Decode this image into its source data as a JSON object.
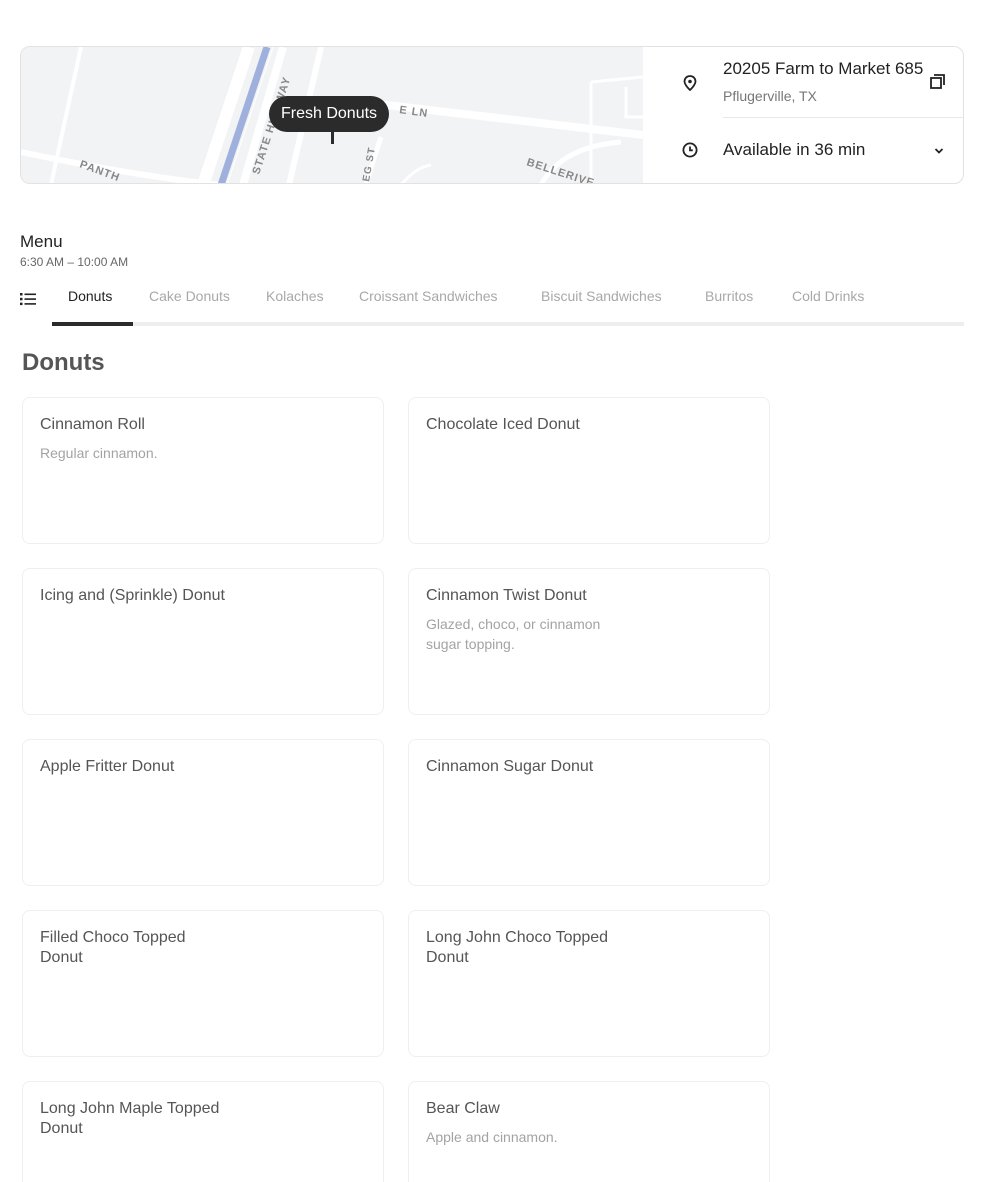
{
  "store": {
    "map_label": "Fresh Donuts",
    "map_street_labels": [
      "STATE HIGHWAY",
      "E LN",
      "PANTH",
      "EG ST",
      "BELLERIVE"
    ],
    "address_line1": "20205 Farm to Market 685",
    "address_line2": "Pflugerville, TX",
    "availability": "Available in 36 min"
  },
  "menu": {
    "title": "Menu",
    "hours": "6:30 AM – 10:00 AM"
  },
  "tabs": [
    {
      "label": "Donuts",
      "active": true
    },
    {
      "label": "Cake Donuts"
    },
    {
      "label": "Kolaches"
    },
    {
      "label": "Croissant Sandwiches"
    },
    {
      "label": "Biscuit Sandwiches"
    },
    {
      "label": "Burritos"
    },
    {
      "label": "Cold Drinks"
    }
  ],
  "section": {
    "title": "Donuts"
  },
  "items": [
    {
      "name": "Cinnamon Roll",
      "description": "Regular cinnamon."
    },
    {
      "name": "Chocolate Iced Donut",
      "description": ""
    },
    {
      "name": "Icing and (Sprinkle) Donut",
      "description": ""
    },
    {
      "name": "Cinnamon Twist Donut",
      "description": "Glazed, choco, or cinnamon sugar topping."
    },
    {
      "name": "Apple Fritter Donut",
      "description": ""
    },
    {
      "name": "Cinnamon Sugar Donut",
      "description": ""
    },
    {
      "name": "Filled Choco Topped Donut",
      "description": ""
    },
    {
      "name": "Long John Choco Topped Donut",
      "description": ""
    },
    {
      "name": "Long John Maple Topped Donut",
      "description": ""
    },
    {
      "name": "Bear Claw",
      "description": "Apple and cinnamon."
    }
  ],
  "icons": {
    "pin": "map-pin-icon",
    "clock": "clock-icon",
    "copy": "copy-icon",
    "chevron": "chevron-down-icon",
    "list": "list-icon"
  },
  "colors": {
    "map_bg": "#f2f3f5",
    "highway": "#9fb0dd",
    "pin": "#2b2b2b"
  }
}
